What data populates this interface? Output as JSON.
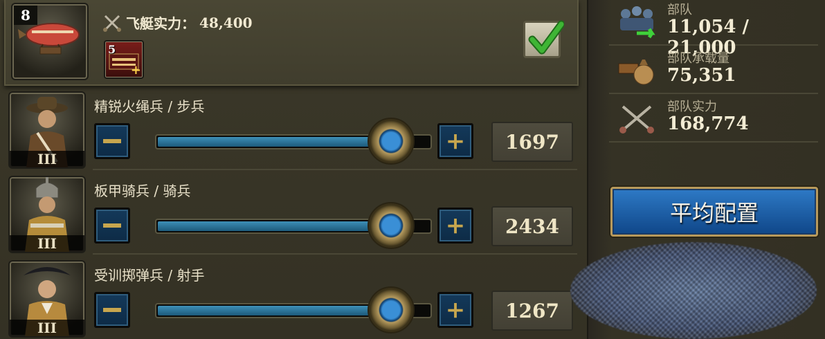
{
  "airship": {
    "level": "8",
    "power_label": "飞艇实力：",
    "power_value": "48,400",
    "item_count": "5",
    "item_plus": "+",
    "selected": true
  },
  "units": [
    {
      "name": "精锐火绳兵 / 步兵",
      "tier": "III",
      "value": "1697",
      "fraction": 0.85
    },
    {
      "name": "板甲骑兵 / 骑兵",
      "tier": "III",
      "value": "2434",
      "fraction": 0.85
    },
    {
      "name": "受训掷弹兵 / 射手",
      "tier": "III",
      "value": "1267",
      "fraction": 0.85
    }
  ],
  "stats": {
    "troops": {
      "label": "部队",
      "value": "11,054 / 21,000"
    },
    "capacity": {
      "label": "部队承载量",
      "value": "75,351"
    },
    "power": {
      "label": "部队实力",
      "value": "168,774"
    }
  },
  "average_button": "平均配置",
  "colors": {
    "slider_fill": "#2f7aa3",
    "button_blue": "#1f5fa8",
    "gold": "#c7a64e",
    "check_green": "#3fb535"
  }
}
